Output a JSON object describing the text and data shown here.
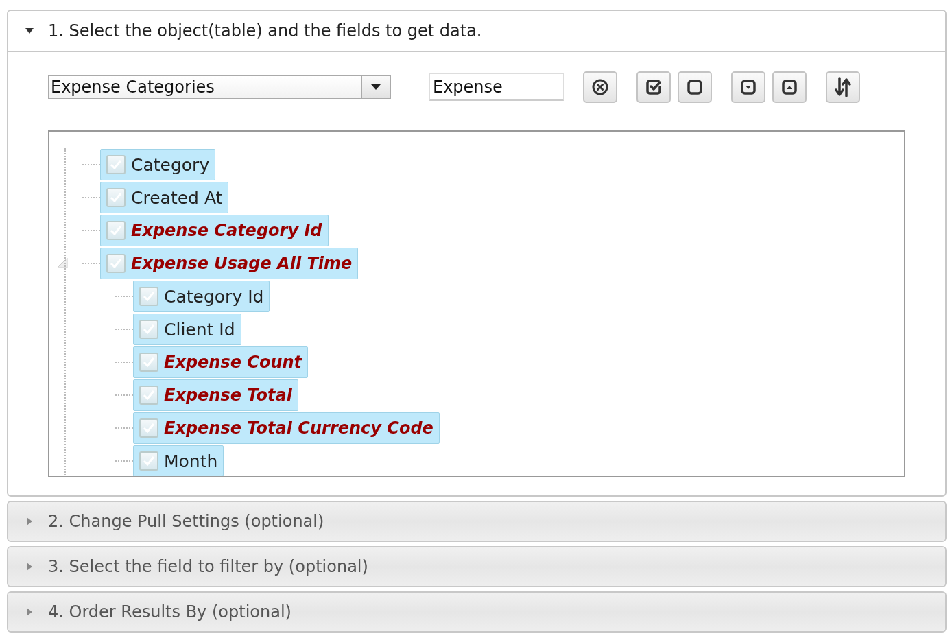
{
  "sections": [
    {
      "title": "1. Select the object(table) and the fields to get data.",
      "expanded": true
    },
    {
      "title": "2. Change Pull Settings (optional)",
      "expanded": false
    },
    {
      "title": "3. Select the field to filter by (optional)",
      "expanded": false
    },
    {
      "title": "4. Order Results By (optional)",
      "expanded": false
    }
  ],
  "object_select": {
    "value": "Expense Categories"
  },
  "filter_field": {
    "value": "Expense"
  },
  "tool_buttons": [
    {
      "kind": "clear"
    },
    {
      "kind": "check-all"
    },
    {
      "kind": "uncheck-all"
    },
    {
      "kind": "expand-all"
    },
    {
      "kind": "collapse-all"
    },
    {
      "kind": "sort"
    }
  ],
  "tree": [
    {
      "label": "Category",
      "checked": true,
      "selected": true,
      "emphasized": false
    },
    {
      "label": "Created At",
      "checked": true,
      "selected": true,
      "emphasized": false
    },
    {
      "label": "Expense Category Id",
      "checked": true,
      "selected": true,
      "emphasized": true
    },
    {
      "label": "Expense Usage All Time",
      "checked": true,
      "selected": true,
      "emphasized": true,
      "expanded": true,
      "children": [
        {
          "label": "Category Id",
          "checked": true,
          "selected": true,
          "emphasized": false
        },
        {
          "label": "Client Id",
          "checked": true,
          "selected": true,
          "emphasized": false
        },
        {
          "label": "Expense Count",
          "checked": true,
          "selected": true,
          "emphasized": true
        },
        {
          "label": "Expense Total",
          "checked": true,
          "selected": true,
          "emphasized": true
        },
        {
          "label": "Expense Total Currency Code",
          "checked": true,
          "selected": true,
          "emphasized": true
        },
        {
          "label": "Month",
          "checked": true,
          "selected": true,
          "emphasized": false
        }
      ]
    }
  ]
}
